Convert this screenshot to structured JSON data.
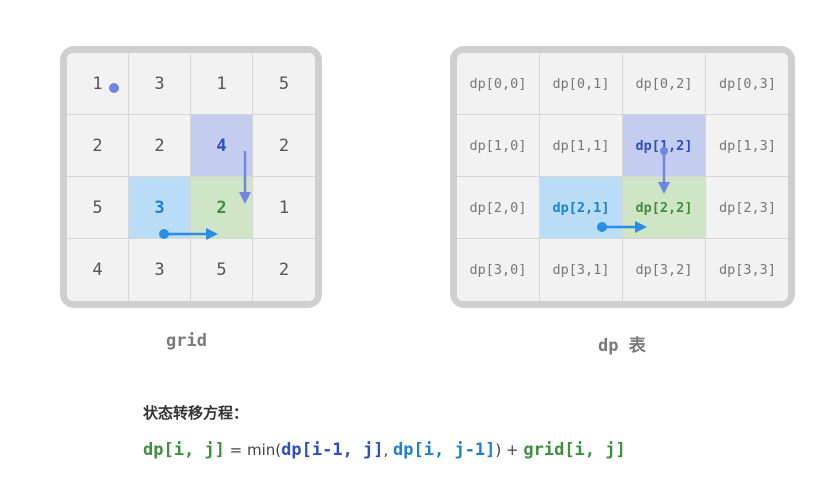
{
  "grid": {
    "caption": "grid",
    "values": [
      [
        "1",
        "3",
        "1",
        "5"
      ],
      [
        "2",
        "2",
        "4",
        "2"
      ],
      [
        "5",
        "3",
        "2",
        "1"
      ],
      [
        "4",
        "3",
        "5",
        "2"
      ]
    ]
  },
  "dp": {
    "caption": "dp 表",
    "labels": [
      [
        "dp[0,0]",
        "dp[0,1]",
        "dp[0,2]",
        "dp[0,3]"
      ],
      [
        "dp[1,0]",
        "dp[1,1]",
        "dp[1,2]",
        "dp[1,3]"
      ],
      [
        "dp[2,0]",
        "dp[2,1]",
        "dp[2,2]",
        "dp[2,3]"
      ],
      [
        "dp[3,0]",
        "dp[3,1]",
        "dp[3,2]",
        "dp[3,3]"
      ]
    ]
  },
  "highlights": {
    "up_color": "#c4cdf0",
    "left_color": "#b9dcf7",
    "current_color": "#cfe5c6"
  },
  "formula": {
    "title": "状态转移方程：",
    "lhs": "dp[i, j]",
    "eq": " = min(",
    "term_up": "dp[i-1, j]",
    "comma": ", ",
    "term_left": "dp[i, j-1]",
    "close_plus": ") + ",
    "term_grid": "grid[i, j]"
  }
}
